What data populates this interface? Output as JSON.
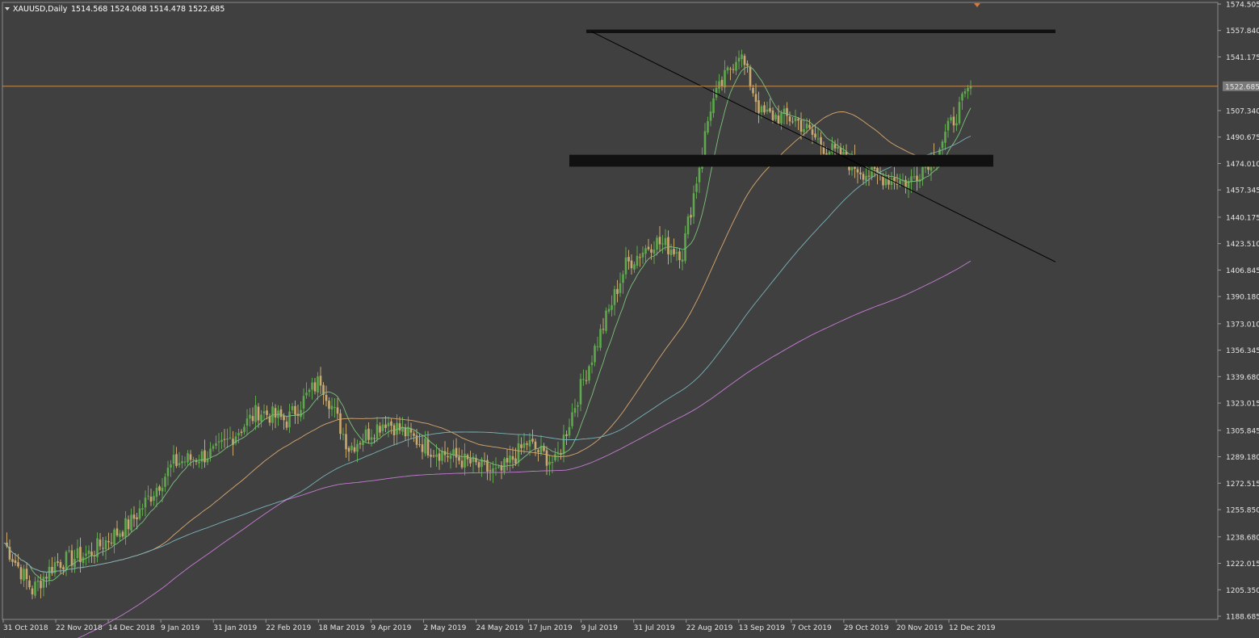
{
  "header": {
    "symbol": "XAUUSD,Daily",
    "ohlc": "1514.568 1524.068 1514.478 1522.685"
  },
  "chart_data": {
    "type": "candlestick",
    "symbol": "XAUUSD",
    "timeframe": "Daily",
    "y_ticks": [
      1574.505,
      1557.84,
      1541.175,
      1507.34,
      1490.675,
      1474.01,
      1457.345,
      1440.175,
      1423.51,
      1406.845,
      1390.18,
      1373.01,
      1356.345,
      1339.68,
      1323.015,
      1305.845,
      1289.18,
      1272.515,
      1255.85,
      1238.68,
      1222.015,
      1205.35,
      1188.685
    ],
    "y_tick_labels": [
      "1574.505",
      "1557.840",
      "1541.175",
      "1507.340",
      "1490.675",
      "1474.010",
      "1457.345",
      "1440.175",
      "1423.510",
      "1406.845",
      "1390.180",
      "1373.010",
      "1356.345",
      "1339.680",
      "1323.015",
      "1305.845",
      "1289.180",
      "1272.515",
      "1255.850",
      "1238.680",
      "1222.015",
      "1205.350",
      "1188.685"
    ],
    "ylim": [
      1188.685,
      1574.505
    ],
    "current_price": 1522.685,
    "current_price_label": "1522.685",
    "x_tick_labels": [
      "31 Oct 2018",
      "22 Nov 2018",
      "14 Dec 2018",
      "9 Jan 2019",
      "31 Jan 2019",
      "22 Feb 2019",
      "18 Mar 2019",
      "9 Apr 2019",
      "2 May 2019",
      "24 May 2019",
      "17 Jun 2019",
      "9 Jul 2019",
      "31 Jul 2019",
      "22 Aug 2019",
      "13 Sep 2019",
      "7 Oct 2019",
      "29 Oct 2019",
      "20 Nov 2019",
      "12 Dec 2019"
    ],
    "bar_count": 300,
    "anchor_closes": [
      [
        0,
        1235
      ],
      [
        10,
        1205
      ],
      [
        18,
        1222
      ],
      [
        30,
        1228
      ],
      [
        45,
        1248
      ],
      [
        60,
        1285
      ],
      [
        75,
        1292
      ],
      [
        90,
        1318
      ],
      [
        100,
        1312
      ],
      [
        112,
        1338
      ],
      [
        122,
        1295
      ],
      [
        135,
        1312
      ],
      [
        150,
        1295
      ],
      [
        165,
        1285
      ],
      [
        175,
        1278
      ],
      [
        185,
        1298
      ],
      [
        195,
        1285
      ],
      [
        205,
        1338
      ],
      [
        220,
        1410
      ],
      [
        230,
        1425
      ],
      [
        240,
        1418
      ],
      [
        250,
        1510
      ],
      [
        260,
        1545
      ],
      [
        268,
        1505
      ],
      [
        280,
        1502
      ],
      [
        290,
        1485
      ],
      [
        305,
        1468
      ],
      [
        320,
        1462
      ],
      [
        330,
        1482
      ],
      [
        342,
        1522
      ]
    ],
    "colors": {
      "background": "#404040",
      "bull_candle": "#5fa84e",
      "bear_candle": "#c9a970",
      "price_line": "#c88b4b",
      "ma_fast": "#7ac27a",
      "ma_mid": "#d8a86e",
      "ma_slow": "#79b2b8",
      "ma_long": "#c67bd4",
      "zone": "#111111",
      "trendline": "#000000",
      "axis_text": "#e6e6e6"
    },
    "zones": [
      {
        "from_bar": 206,
        "to_bar": 372,
        "y_top": 1558.4,
        "y_bottom": 1556.2
      },
      {
        "from_bar": 200,
        "to_bar": 350,
        "y_top": 1479.5,
        "y_bottom": 1472.0
      }
    ],
    "trendline": {
      "from_bar": 208,
      "from_price": 1557,
      "to_bar": 372,
      "to_price": 1412
    }
  }
}
